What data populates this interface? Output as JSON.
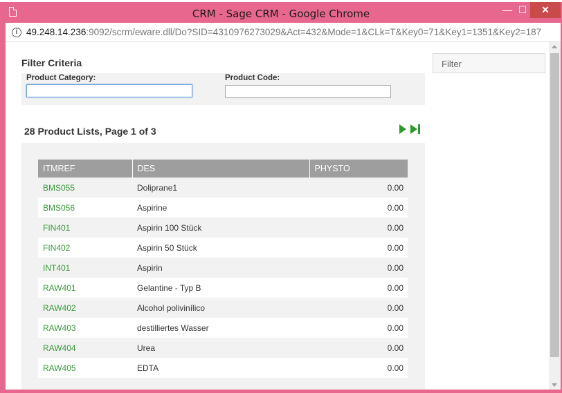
{
  "window": {
    "title": "CRM - Sage CRM - Google Chrome",
    "minimize": "—",
    "maximize": "☐",
    "close": "✕"
  },
  "address": {
    "host": "49.248.14.236",
    "rest": ":9092/scrm/eware.dll/Do?SID=4310976273029&Act=432&Mode=1&CLk=T&Key0=71&Key1=1351&Key2=187"
  },
  "filter": {
    "title": "Filter Criteria",
    "category_label": "Product Category:",
    "code_label": "Product Code:",
    "category_value": "",
    "code_value": "",
    "button": "Filter"
  },
  "list": {
    "title": "28 Product Lists, Page 1 of 3",
    "columns": [
      "ITMREF",
      "DES",
      "PHYSTO"
    ],
    "rows": [
      {
        "itmref": "BMS055",
        "des": "Doliprane1",
        "physto": "0.00"
      },
      {
        "itmref": "BMS056",
        "des": "Aspirine",
        "physto": "0.00"
      },
      {
        "itmref": "FIN401",
        "des": "Aspirin 100 Stück",
        "physto": "0.00"
      },
      {
        "itmref": "FIN402",
        "des": "Aspirin 50 Stück",
        "physto": "0.00"
      },
      {
        "itmref": "INT401",
        "des": "Aspirin",
        "physto": "0.00"
      },
      {
        "itmref": "RAW401",
        "des": "Gelantine - Typ B",
        "physto": "0.00"
      },
      {
        "itmref": "RAW402",
        "des": "Alcohol polivinílico",
        "physto": "0.00"
      },
      {
        "itmref": "RAW403",
        "des": "destilliertes Wasser",
        "physto": "0.00"
      },
      {
        "itmref": "RAW404",
        "des": "Urea",
        "physto": "0.00"
      },
      {
        "itmref": "RAW405",
        "des": "EDTA",
        "physto": "0.00"
      }
    ]
  },
  "colors": {
    "frame": "#e8678f",
    "link": "#3a9a3a",
    "header": "#9e9e9e"
  }
}
